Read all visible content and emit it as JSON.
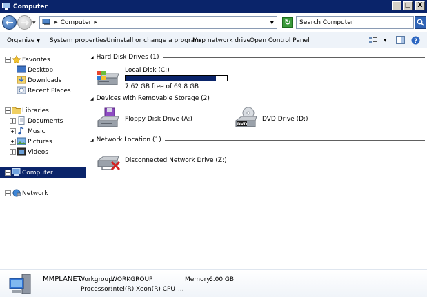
{
  "window": {
    "title": "Computer",
    "minimize_glyph": "_",
    "maximize_glyph": "□",
    "close_glyph": "X"
  },
  "address": {
    "crumb": "Computer",
    "search_placeholder": "Search Computer"
  },
  "toolbar": {
    "organize": "Organize",
    "system_properties": "System properties",
    "uninstall": "Uninstall or change a program",
    "map_drive": "Map network drive",
    "control_panel": "Open Control Panel"
  },
  "nav": {
    "favorites": "Favorites",
    "desktop": "Desktop",
    "downloads": "Downloads",
    "recent": "Recent Places",
    "libraries": "Libraries",
    "documents": "Documents",
    "music": "Music",
    "pictures": "Pictures",
    "videos": "Videos",
    "computer": "Computer",
    "network": "Network"
  },
  "groups": {
    "hdd": "Hard Disk Drives (1)",
    "removable": "Devices with Removable Storage (2)",
    "network": "Network Location (1)"
  },
  "items": {
    "local_disk": {
      "name": "Local Disk (C:)",
      "free_text": "7.62 GB free of 69.8 GB",
      "used_fraction": 0.89
    },
    "floppy": "Floppy Disk Drive (A:)",
    "dvd": "DVD Drive (D:)",
    "dvd_badge": "DVD",
    "netdrive": "Disconnected Network Drive (Z:)"
  },
  "details": {
    "computer_name": "MMPLANET",
    "workgroup_label": "Workgroup:",
    "workgroup_value": "WORKGROUP",
    "memory_label": "Memory:",
    "memory_value": "6.00 GB",
    "processor_label": "Processor:",
    "processor_value": "Intel(R) Xeon(R) CPU",
    "ellipsis": "..."
  },
  "colors": {
    "title_bar": "#0a246a",
    "selection": "#0a246a",
    "toolbar_bg": "#eef3f9"
  }
}
